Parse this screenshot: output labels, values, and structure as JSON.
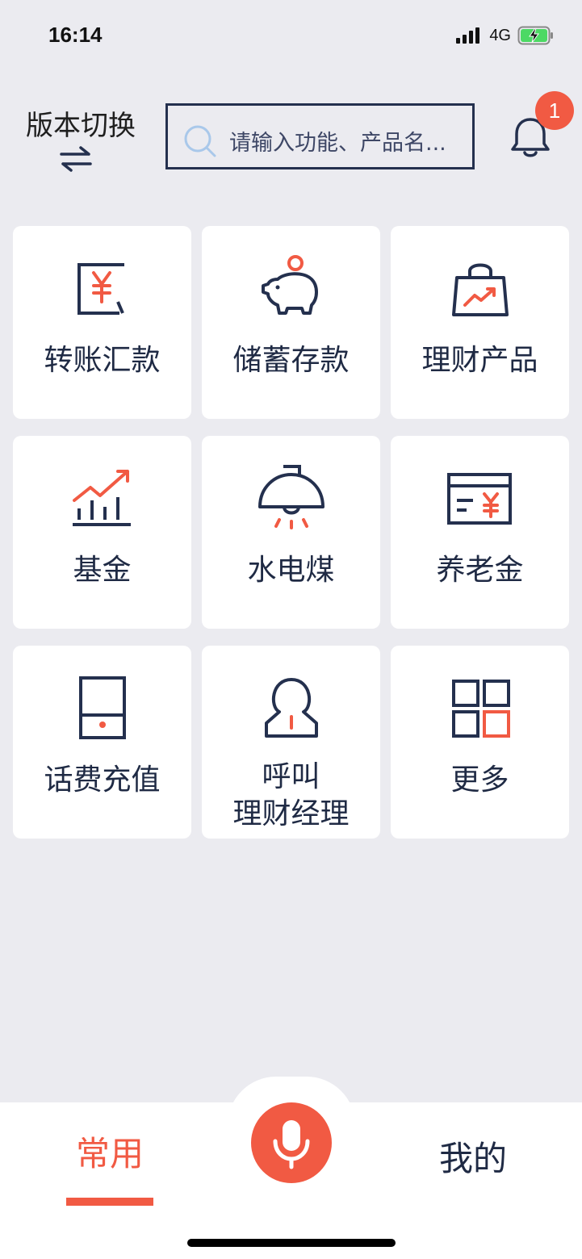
{
  "status_bar": {
    "time": "16:14",
    "network": "4G"
  },
  "header": {
    "version_switch_label": "版本切换",
    "search_placeholder": "请输入功能、产品名...",
    "notification_count": "1"
  },
  "tiles": [
    {
      "label": "转账汇款",
      "icon": "transfer-yuan-icon"
    },
    {
      "label": "储蓄存款",
      "icon": "piggy-bank-icon"
    },
    {
      "label": "理财产品",
      "icon": "shopping-bag-chart-icon"
    },
    {
      "label": "基金",
      "icon": "bar-chart-trend-icon"
    },
    {
      "label": "水电煤",
      "icon": "ceiling-lamp-icon"
    },
    {
      "label": "养老金",
      "icon": "pension-card-icon"
    },
    {
      "label": "话费充值",
      "icon": "phone-device-icon"
    },
    {
      "label_line1": "呼叫",
      "label_line2": "理财经理",
      "icon": "person-icon"
    },
    {
      "label": "更多",
      "icon": "grid-more-icon"
    }
  ],
  "tabbar": {
    "common_label": "常用",
    "mine_label": "我的",
    "mic_icon": "microphone-icon"
  },
  "colors": {
    "accent": "#F15A43",
    "navy": "#24304E",
    "background": "#EBEBF0"
  }
}
